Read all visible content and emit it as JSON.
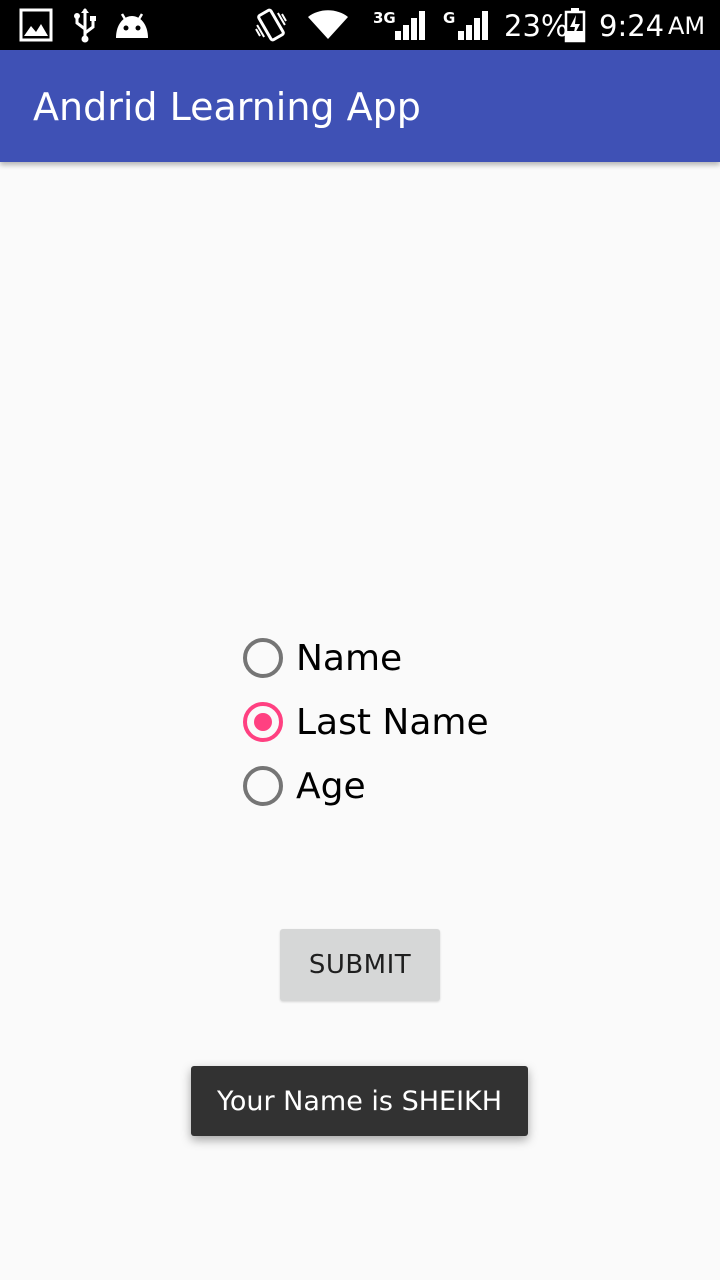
{
  "status_bar": {
    "icons": [
      "gallery-icon",
      "usb-icon",
      "android-icon",
      "vibrate-icon",
      "wifi-icon",
      "signal-3g-icon",
      "signal-g-icon",
      "battery-charging-icon"
    ],
    "network_3g_label": "3G",
    "network_g_label": "G",
    "battery_percent": "23%",
    "time": "9:24",
    "ampm": "AM"
  },
  "app_bar": {
    "title": "Andrid Learning App"
  },
  "radio_group": {
    "options": [
      {
        "label": "Name",
        "checked": false
      },
      {
        "label": "Last Name",
        "checked": true
      },
      {
        "label": "Age",
        "checked": false
      }
    ]
  },
  "submit_button": {
    "label": "SUBMIT"
  },
  "toast": {
    "message": "Your Name is SHEIKH"
  },
  "colors": {
    "app_bar": "#3f51b5",
    "accent": "#ff4081",
    "background": "#fafafa",
    "status_bar": "#000000",
    "toast": "#323232",
    "button": "#d6d7d7"
  }
}
